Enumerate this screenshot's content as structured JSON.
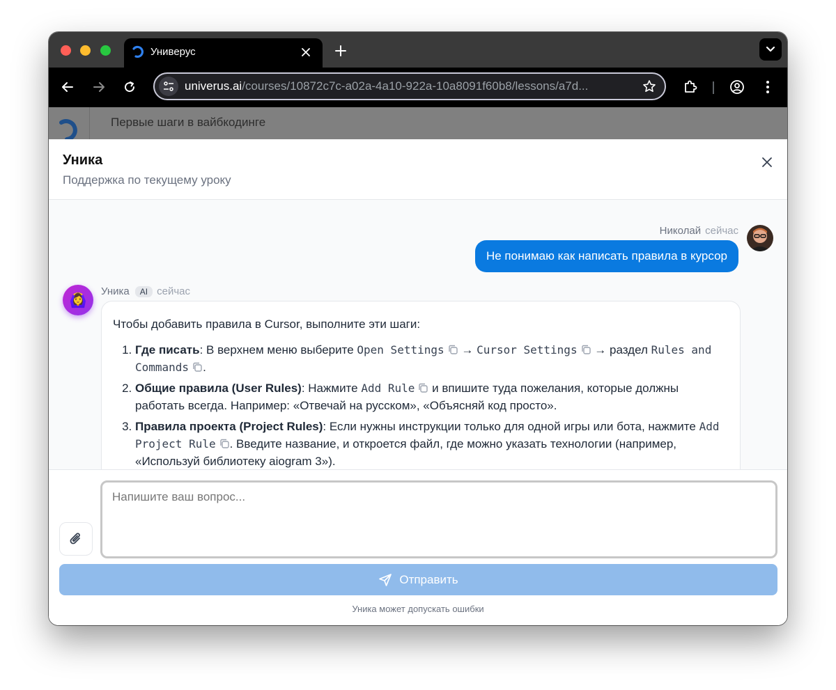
{
  "browser": {
    "tab_title": "Универус",
    "url_host": "univerus.ai",
    "url_path": "/courses/10872c7c-a02a-4a10-922a-10a8091f60b8/lessons/a7d..."
  },
  "app": {
    "header_title": "Первые шаги в вайбкодинге"
  },
  "panel": {
    "title": "Уника",
    "subtitle": "Поддержка по текущему уроку"
  },
  "messages": {
    "user": {
      "name": "Николай",
      "time": "сейчас",
      "text": "Не понимаю как написать правила в курсор"
    },
    "ai": {
      "name": "Уника",
      "badge": "AI",
      "time": "сейчас",
      "avatar_emoji": "🙆‍♀️",
      "intro": "Чтобы добавить правила в Cursor, выполните эти шаги:",
      "steps": [
        {
          "title": "Где писать",
          "t1": ": В верхнем меню выберите ",
          "code1": "Open Settings",
          "arrow1": " → ",
          "code2": "Cursor Settings",
          "t2": " → раздел ",
          "code3": "Rules and Commands",
          "t3": "."
        },
        {
          "title": "Общие правила (User Rules)",
          "t1": ": Нажмите ",
          "code1": "Add Rule",
          "t2": " и впишите туда пожелания, которые должны работать всегда. Например: «Отвечай на русском», «Объясняй код просто»."
        },
        {
          "title": "Правила проекта (Project Rules)",
          "t1": ": Если нужны инструкции только для одной игры или бота, нажмите ",
          "code1": "Add Project Rule",
          "t2": ". Введите название, и откроется файл, где можно указать технологии (например, «Используй библиотеку aiogram 3»)."
        }
      ]
    }
  },
  "composer": {
    "placeholder": "Напишите ваш вопрос...",
    "value": "",
    "send_label": "Отправить",
    "disclaimer": "Уника может допускать ошибки"
  },
  "colors": {
    "accent": "#0a7ae0",
    "send_disabled": "#90bbeb",
    "ai_avatar": "#9333ea"
  }
}
